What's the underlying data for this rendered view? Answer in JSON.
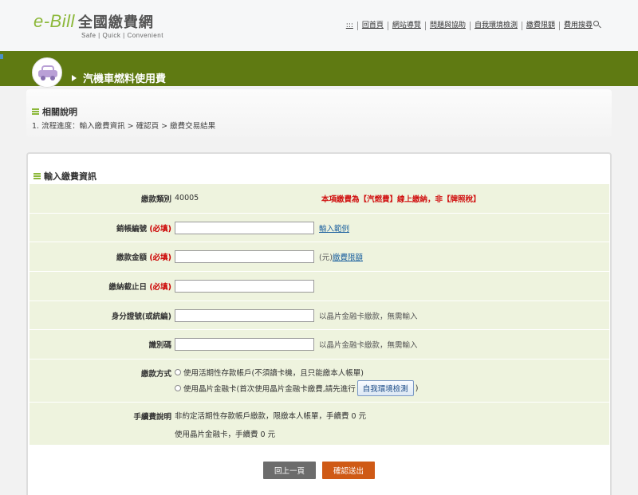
{
  "header": {
    "logo_text": "e-Bill",
    "logo_cn": "全國繳費網",
    "logo_sub": "Safe | Quick | Convenient",
    "nav": [
      ":::",
      "回首頁",
      "網站導覽",
      "問題與協助",
      "自我環境檢測",
      "繳費限額",
      "費用搜尋"
    ]
  },
  "banner": {
    "title": "汽機車燃料使用費"
  },
  "info": {
    "title": "相關說明",
    "steps": "1. 流程進度：輸入繳費資訊 > 確認頁 > 繳費交易結果"
  },
  "form": {
    "title": "輸入繳費資訊",
    "required": "(必填)",
    "type": {
      "label": "繳款類別",
      "value": "40005",
      "notice": "本項繳費為【汽燃費】線上繳納，非【牌照稅】"
    },
    "account": {
      "label": "銷帳編號",
      "value": "",
      "link": "輸入範例"
    },
    "amount": {
      "label": "繳款金額",
      "value": "",
      "unit": "(元)",
      "link": "繳費限額"
    },
    "due_date": {
      "label": "繳納截止日",
      "value": ""
    },
    "id_no": {
      "label": "身分證號(或統編)",
      "value": "",
      "hint": "以晶片金融卡繳款，無需輸入"
    },
    "code": {
      "label": "識別碼",
      "value": "",
      "hint": "以晶片金融卡繳款，無需輸入"
    },
    "pay_method": {
      "label": "繳款方式",
      "option1": "使用活期性存款帳戶(不須讀卡機，且只能繳本人帳單)",
      "option2_pre": "使用晶片金融卡(首次使用晶片金融卡繳費,請先進行",
      "env_button": "自我環境檢測",
      "option2_post": ")"
    },
    "fee": {
      "label": "手續費說明",
      "line1": "非約定活期性存款帳戶繳款，限繳本人帳單，手續費 0 元",
      "line2": "使用晶片金融卡，手續費 0 元"
    },
    "back_button": "回上一頁",
    "submit_button": "確認送出"
  },
  "colors": {
    "green_band": "#5f7a12",
    "row_bg": "#eef3de",
    "accent_red": "#d01010",
    "submit": "#cf5a16"
  }
}
